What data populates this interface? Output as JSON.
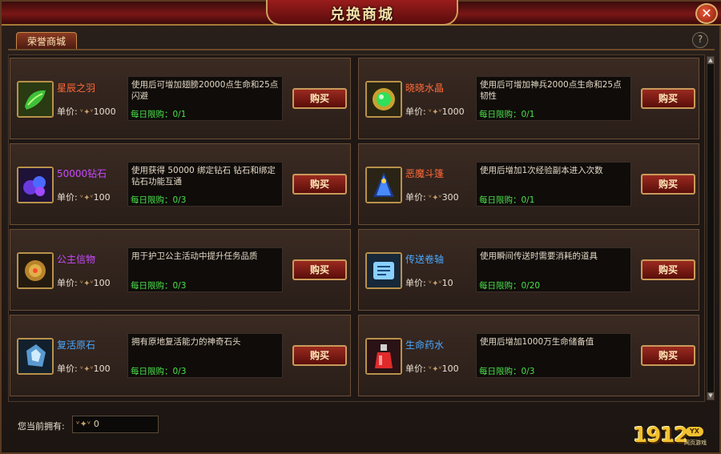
{
  "window": {
    "title": "兑换商城",
    "close_label": "✕",
    "help_label": "?"
  },
  "tabs": [
    {
      "label": "荣誉商城"
    }
  ],
  "items": [
    {
      "name": "星辰之羽",
      "name_color": "#ff6a3a",
      "price_label": "单价:",
      "price": "1000",
      "desc": "使用后可增加翅膀20000点生命和25点闪避",
      "limit": "每日限购：0/1",
      "buy": "购买",
      "icon": "green-leaf-icon"
    },
    {
      "name": "晓晓水晶",
      "name_color": "#ff6a3a",
      "price_label": "单价:",
      "price": "1000",
      "desc": "使用后可增加神兵2000点生命和25点韧性",
      "limit": "每日限购：0/1",
      "buy": "购买",
      "icon": "green-orb-icon"
    },
    {
      "name": "50000钻石",
      "name_color": "#c94aff",
      "price_label": "单价:",
      "price": "100",
      "desc": "使用获得 50000 绑定钻石 钻石和绑定钻石功能互通",
      "limit": "每日限购：0/3",
      "buy": "购买",
      "icon": "purple-gems-icon"
    },
    {
      "name": "恶魔斗篷",
      "name_color": "#ff6a3a",
      "price_label": "单价:",
      "price": "300",
      "desc": "使用后增加1次经验副本进入次数",
      "limit": "每日限购：0/1",
      "buy": "购买",
      "icon": "demon-cloak-icon"
    },
    {
      "name": "公主信物",
      "name_color": "#c94aff",
      "price_label": "单价:",
      "price": "100",
      "desc": "用于护卫公主活动中提升任务品质",
      "limit": "每日限购：0/3",
      "buy": "购买",
      "icon": "princess-token-icon"
    },
    {
      "name": "传送卷轴",
      "name_color": "#4aa8ff",
      "price_label": "单价:",
      "price": "10",
      "desc": "使用瞬间传送时需要消耗的道具",
      "limit": "每日限购：0/20",
      "buy": "购买",
      "icon": "teleport-scroll-icon"
    },
    {
      "name": "复活原石",
      "name_color": "#4aa8ff",
      "price_label": "单价:",
      "price": "100",
      "desc": "拥有原地复活能力的神奇石头",
      "limit": "每日限购：0/3",
      "buy": "购买",
      "icon": "revive-stone-icon"
    },
    {
      "name": "生命药水",
      "name_color": "#4aa8ff",
      "price_label": "单价:",
      "price": "100",
      "desc": "使用后增加1000万生命储备值",
      "limit": "每日限购：0/3",
      "buy": "购买",
      "icon": "life-potion-icon"
    }
  ],
  "footer": {
    "owned_label": "您当前拥有:",
    "owned_value": "0"
  },
  "logo": {
    "text": "1912",
    "badge": "YX",
    "sub": "网页游戏"
  }
}
